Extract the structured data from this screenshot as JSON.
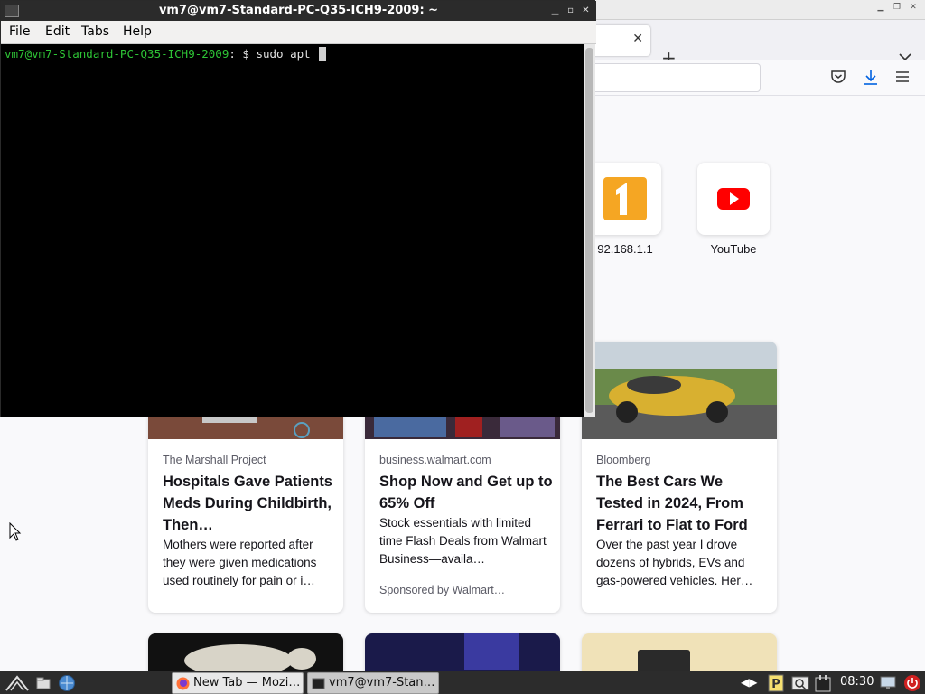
{
  "terminal": {
    "title": "vm7@vm7-Standard-PC-Q35-ICH9-2009: ~",
    "menu": [
      "File",
      "Edit",
      "Tabs",
      "Help"
    ],
    "prompt_user": "vm7@vm7-Standard-PC-Q35-ICH9-2009",
    "prompt_sep": ": $ ",
    "command": "sudo apt "
  },
  "firefox": {
    "top_sites": [
      {
        "label": "92.168.1.1",
        "icon": "number-one-icon",
        "color": "#f5a623"
      },
      {
        "label": "YouTube",
        "icon": "youtube-icon",
        "color": "#ff0000"
      }
    ],
    "cards": [
      {
        "source": "The Marshall Project",
        "title": "Hospitals Gave Patients Meds During Childbirth, Then…",
        "desc": "Mothers were reported after they were given medications used routinely for pain or i…"
      },
      {
        "source": "business.walmart.com",
        "title": "Shop Now and Get up to 65% Off",
        "desc": "Stock essentials with limited time Flash Deals from Walmart Business—availa…",
        "sponsor": "Sponsored by Walmart…"
      },
      {
        "source": "Bloomberg",
        "title": "The Best Cars We Tested in 2024, From Ferrari to Fiat to Ford",
        "desc": "Over the past year I drove dozens of hybrids, EVs and gas-powered vehicles. Her…"
      }
    ]
  },
  "taskbar": {
    "tasks": [
      {
        "label": "New Tab — Mozi…",
        "icon": "firefox-icon"
      },
      {
        "label": "vm7@vm7-Stan…",
        "icon": "terminal-icon"
      }
    ],
    "clock": "08:30"
  }
}
